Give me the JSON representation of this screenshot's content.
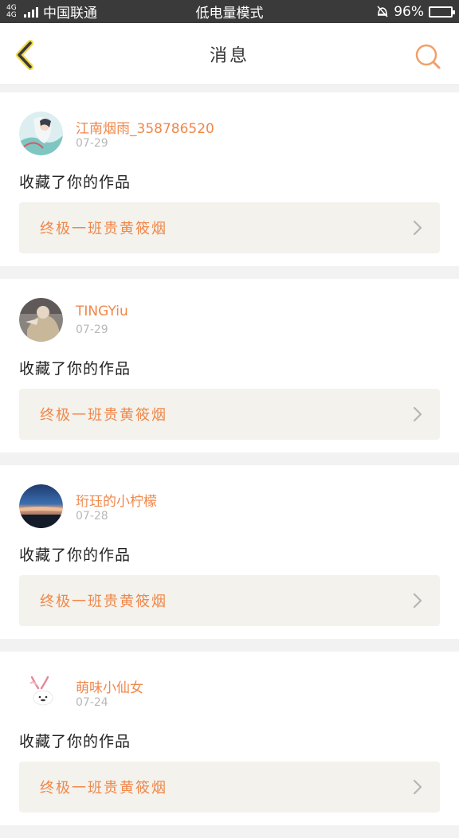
{
  "status_bar": {
    "network": "4G 4G",
    "carrier": "中国联通",
    "mode": "低电量模式",
    "battery_percent": "96%",
    "battery_level": 0.96,
    "icons": [
      "signal-icon",
      "mute-bell-icon",
      "battery-icon"
    ]
  },
  "header": {
    "title": "消息",
    "back_icon": "chevron-left-icon",
    "search_icon": "search-icon",
    "accent": "#f0874a"
  },
  "messages": [
    {
      "username": "江南烟雨_358786520",
      "date": "07-29",
      "action": "收藏了你的作品",
      "work_title": "终极一班贵黄筱烟",
      "avatar": "anime-girl-avatar"
    },
    {
      "username": "TINGYiu",
      "date": "07-29",
      "action": "收藏了你的作品",
      "work_title": "终极一班贵黄筱烟",
      "avatar": "doll-avatar"
    },
    {
      "username": "珩珏的小柠檬",
      "date": "07-28",
      "action": "收藏了你的作品",
      "work_title": "终极一班贵黄筱烟",
      "avatar": "sunset-sea-avatar"
    },
    {
      "username": "萌味小仙女",
      "date": "07-24",
      "action": "收藏了你的作品",
      "work_title": "终极一班贵黄筱烟",
      "avatar": "cartoon-rabbit-avatar"
    }
  ]
}
